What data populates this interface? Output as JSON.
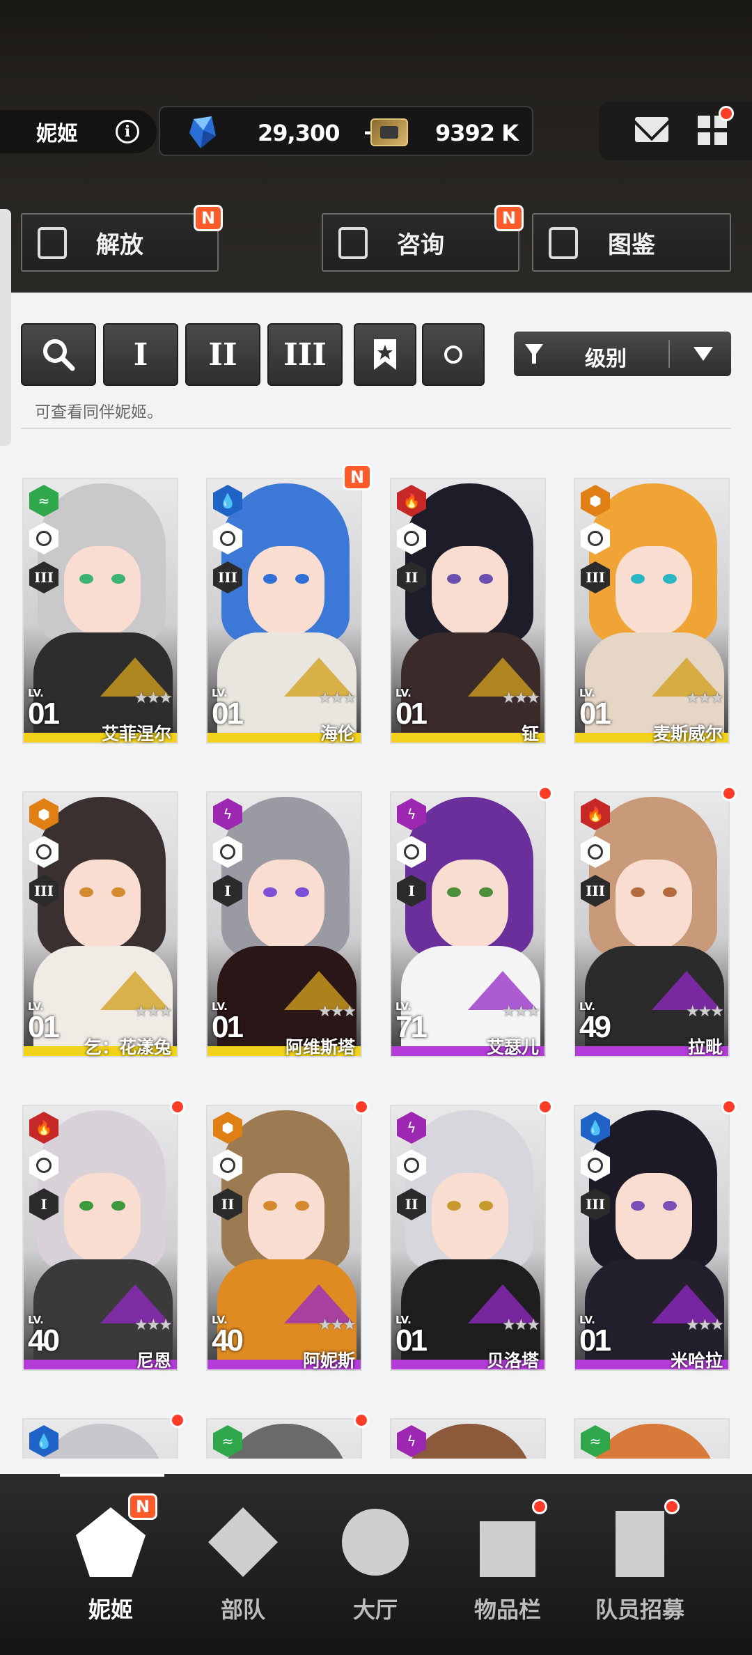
{
  "header": {
    "player_name": "妮姬",
    "info_icon": "info-icon",
    "gems": "29,300",
    "gem_plus": "+",
    "credits": "9392 K",
    "mail_icon": "mail-icon",
    "menu_icon": "menu-icon"
  },
  "nav_buttons": [
    {
      "label": "解放",
      "badge": "N",
      "icon": "unlock-icon"
    },
    {
      "label": "咨询",
      "badge": "N",
      "icon": "calendar-icon"
    },
    {
      "label": "图鉴",
      "badge": "",
      "icon": "codex-icon"
    }
  ],
  "filters": {
    "search_icon": "search-icon",
    "burst_1": "I",
    "burst_2": "II",
    "burst_3": "III",
    "favorite_icon": "bookmark-star-icon",
    "circle_icon": "circle-icon",
    "sort_label": "级别",
    "hint": "可查看同伴妮姬。"
  },
  "characters": [
    {
      "name": "艾菲涅尔",
      "level": "01",
      "burst": "III",
      "element": "wind",
      "element_color": "#2ea84a",
      "rarity": "SSR",
      "badge": "",
      "lv_label": "LV.",
      "hair": "#c9c9cc",
      "body": "#2d2d2d",
      "eye": "#3cb371"
    },
    {
      "name": "海伦",
      "level": "01",
      "burst": "III",
      "element": "water",
      "element_color": "#1f63c6",
      "rarity": "SSR",
      "badge": "N",
      "lv_label": "LV.",
      "hair": "#3c79d6",
      "body": "#e9e6e0",
      "eye": "#2f6fd6"
    },
    {
      "name": "钲",
      "level": "01",
      "burst": "II",
      "element": "fire",
      "element_color": "#c62828",
      "rarity": "SSR",
      "badge": "",
      "lv_label": "LV.",
      "hair": "#1d1d2a",
      "body": "#3a2a2a",
      "eye": "#6a4fb0"
    },
    {
      "name": "麦斯威尔",
      "level": "01",
      "burst": "III",
      "element": "iron",
      "element_color": "#e07f14",
      "rarity": "SSR",
      "badge": "",
      "lv_label": "LV.",
      "hair": "#f0a436",
      "body": "#e5d6c6",
      "eye": "#2bb6c6"
    },
    {
      "name": "乞：花漾兔",
      "level": "01",
      "burst": "III",
      "element": "iron",
      "element_color": "#e07f14",
      "rarity": "SSR",
      "badge": "",
      "lv_label": "LV.",
      "hair": "#3a3030",
      "body": "#f1ebe6",
      "eye": "#d48a2e"
    },
    {
      "name": "阿维斯塔",
      "level": "01",
      "burst": "I",
      "element": "electric",
      "element_color": "#9c27b0",
      "rarity": "SSR",
      "badge": "",
      "lv_label": "LV.",
      "hair": "#9a9aa2",
      "body": "#2a1616",
      "eye": "#7b4fd6"
    },
    {
      "name": "艾瑟儿",
      "level": "71",
      "burst": "I",
      "element": "electric",
      "element_color": "#9c27b0",
      "rarity": "SR",
      "badge": "dot",
      "lv_label": "LV.",
      "hair": "#6a2f9a",
      "body": "#f4f4f4",
      "eye": "#4b8f3a"
    },
    {
      "name": "拉毗",
      "level": "49",
      "burst": "III",
      "element": "fire",
      "element_color": "#c62828",
      "rarity": "SR",
      "badge": "dot",
      "lv_label": "LV.",
      "hair": "#c89a7a",
      "body": "#2b2b2b",
      "eye": "#b36a3c"
    },
    {
      "name": "尼恩",
      "level": "40",
      "burst": "I",
      "element": "fire",
      "element_color": "#c62828",
      "rarity": "SR",
      "badge": "dot",
      "lv_label": "LV.",
      "hair": "#d8d2d8",
      "body": "#3a3a3a",
      "eye": "#3c9a3c"
    },
    {
      "name": "阿妮斯",
      "level": "40",
      "burst": "II",
      "element": "iron",
      "element_color": "#e07f14",
      "rarity": "SR",
      "badge": "dot",
      "lv_label": "LV.",
      "hair": "#9c7a52",
      "body": "#e08a22",
      "eye": "#d48a2e"
    },
    {
      "name": "贝洛塔",
      "level": "01",
      "burst": "II",
      "element": "electric",
      "element_color": "#9c27b0",
      "rarity": "SR",
      "badge": "dot",
      "lv_label": "LV.",
      "hair": "#d6d6dc",
      "body": "#1e1e1e",
      "eye": "#c89a2e"
    },
    {
      "name": "米哈拉",
      "level": "01",
      "burst": "III",
      "element": "water",
      "element_color": "#1f63c6",
      "rarity": "SR",
      "badge": "dot",
      "lv_label": "LV.",
      "hair": "#1c1a26",
      "body": "#231f2c",
      "eye": "#7a4fb6"
    },
    {
      "name": "",
      "level": "",
      "burst": "",
      "element": "water",
      "element_color": "#1f63c6",
      "rarity": "",
      "badge": "dot",
      "lv_label": "",
      "hair": "#c8c8cc",
      "body": "#333",
      "eye": "#333"
    },
    {
      "name": "",
      "level": "",
      "burst": "",
      "element": "wind",
      "element_color": "#2ea84a",
      "rarity": "",
      "badge": "dot",
      "lv_label": "",
      "hair": "#6a6a6a",
      "body": "#333",
      "eye": "#333"
    },
    {
      "name": "",
      "level": "",
      "burst": "",
      "element": "electric",
      "element_color": "#9c27b0",
      "rarity": "",
      "badge": "",
      "lv_label": "",
      "hair": "#8a5a3a",
      "body": "#333",
      "eye": "#333"
    },
    {
      "name": "",
      "level": "",
      "burst": "",
      "element": "wind",
      "element_color": "#2ea84a",
      "rarity": "",
      "badge": "",
      "lv_label": "",
      "hair": "#d87a3a",
      "body": "#333",
      "eye": "#333"
    }
  ],
  "rarity_colors": {
    "SSR": "#f2d21a",
    "SR": "#b33cd6"
  },
  "star_glyphs": "★★★",
  "tabs": [
    {
      "label": "妮姬",
      "icon": "nikke-icon",
      "badge": "N",
      "active": true
    },
    {
      "label": "部队",
      "icon": "squad-icon",
      "badge": "",
      "active": false
    },
    {
      "label": "大厅",
      "icon": "lobby-icon",
      "badge": "",
      "active": false
    },
    {
      "label": "物品栏",
      "icon": "inventory-icon",
      "badge": "dot",
      "active": false
    },
    {
      "label": "队员招募",
      "icon": "recruit-icon",
      "badge": "dot",
      "active": false
    }
  ]
}
